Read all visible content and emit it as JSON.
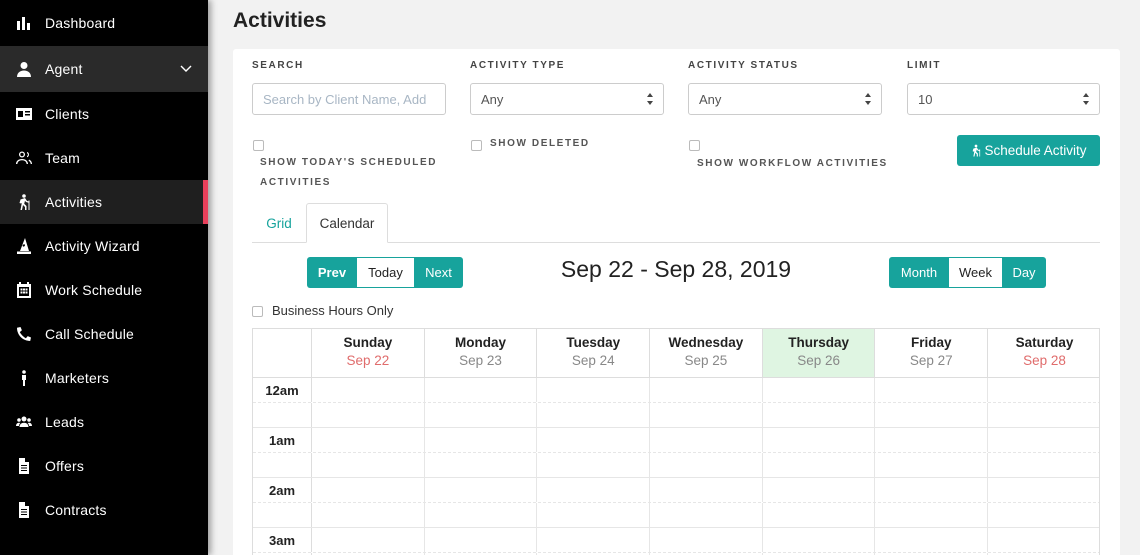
{
  "sidebar": {
    "items": [
      {
        "label": "Dashboard",
        "icon": "bar-chart-icon"
      },
      {
        "label": "Agent",
        "icon": "user-icon"
      },
      {
        "label": "Clients",
        "icon": "id-card-icon"
      },
      {
        "label": "Team",
        "icon": "users-outline-icon"
      },
      {
        "label": "Activities",
        "icon": "hiking-icon"
      },
      {
        "label": "Activity Wizard",
        "icon": "wizard-hat-icon"
      },
      {
        "label": "Work Schedule",
        "icon": "calendar-icon"
      },
      {
        "label": "Call Schedule",
        "icon": "phone-icon"
      },
      {
        "label": "Marketers",
        "icon": "person-icon"
      },
      {
        "label": "Leads",
        "icon": "group-icon"
      },
      {
        "label": "Offers",
        "icon": "file-icon"
      },
      {
        "label": "Contracts",
        "icon": "file-icon"
      }
    ],
    "active": "Activities"
  },
  "page": {
    "title": "Activities"
  },
  "filters": {
    "search_label": "SEARCH",
    "search_placeholder": "Search by Client Name, Add",
    "type_label": "ACTIVITY TYPE",
    "type_value": "Any",
    "status_label": "ACTIVITY STATUS",
    "status_value": "Any",
    "limit_label": "LIMIT",
    "limit_value": "10"
  },
  "options": {
    "today_line1": "SHOW TODAY'S SCHEDULED",
    "today_line2": "ACTIVITIES",
    "deleted": "SHOW DELETED",
    "workflow": "SHOW WORKFLOW ACTIVITIES"
  },
  "schedule_button": "Schedule Activity",
  "tabs": {
    "grid": "Grid",
    "calendar": "Calendar"
  },
  "nav": {
    "prev": "Prev",
    "today": "Today",
    "next": "Next"
  },
  "date_range": "Sep 22 - Sep 28, 2019",
  "views": {
    "month": "Month",
    "week": "Week",
    "day": "Day"
  },
  "business_hours": "Business Hours Only",
  "calendar": {
    "days": [
      {
        "name": "Sunday",
        "date": "Sep 22"
      },
      {
        "name": "Monday",
        "date": "Sep 23"
      },
      {
        "name": "Tuesday",
        "date": "Sep 24"
      },
      {
        "name": "Wednesday",
        "date": "Sep 25"
      },
      {
        "name": "Thursday",
        "date": "Sep 26"
      },
      {
        "name": "Friday",
        "date": "Sep 27"
      },
      {
        "name": "Saturday",
        "date": "Sep 28"
      }
    ],
    "hours": [
      "12am",
      "1am",
      "2am",
      "3am"
    ],
    "colors": {
      "teal": "#17a39c",
      "today_bg": "#dff5e2",
      "weekend_date": "#e06c6c",
      "active_marker": "#e8405b"
    }
  }
}
